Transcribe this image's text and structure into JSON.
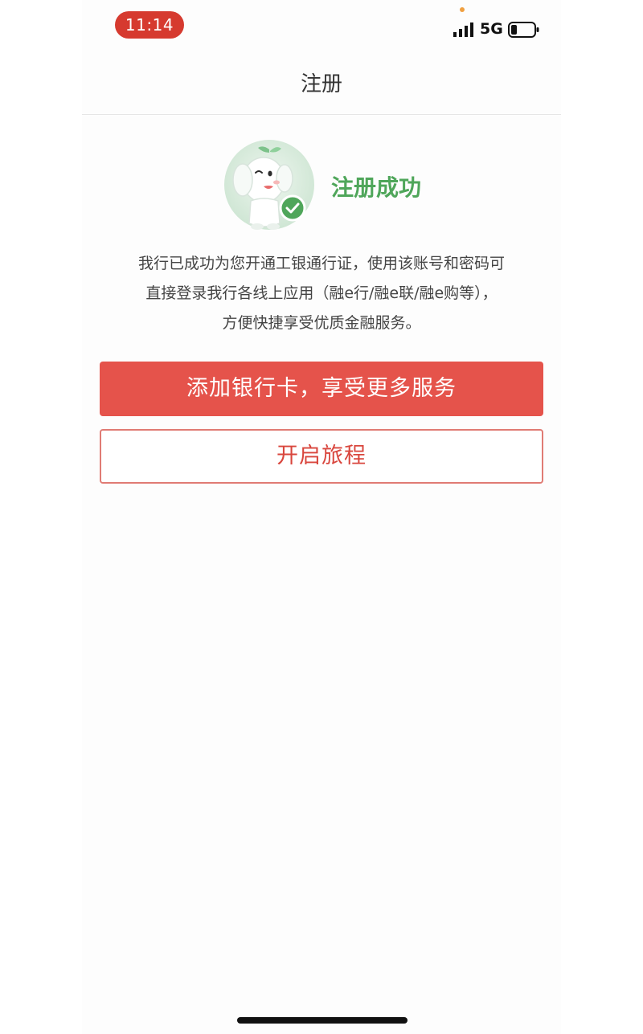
{
  "status_bar": {
    "time": "11:14",
    "network": "5G",
    "signal_icon": "cellular-signal-icon",
    "battery_icon": "battery-low-icon",
    "time_pill_color": "#d63a2f"
  },
  "nav": {
    "title": "注册"
  },
  "success": {
    "title": "注册成功",
    "mascot_icon": "elephant-mascot-checkmark-icon",
    "title_color": "#4fa65a",
    "description_lines": [
      "我行已成功为您开通工银通行证，使用该账号和密码可",
      "直接登录我行各线上应用（融e行/融e联/融e购等），",
      "方便快捷享受优质金融服务。"
    ]
  },
  "actions": {
    "add_card_label": "添加银行卡，享受更多服务",
    "start_label": "开启旅程",
    "primary_color": "#e5534b"
  }
}
